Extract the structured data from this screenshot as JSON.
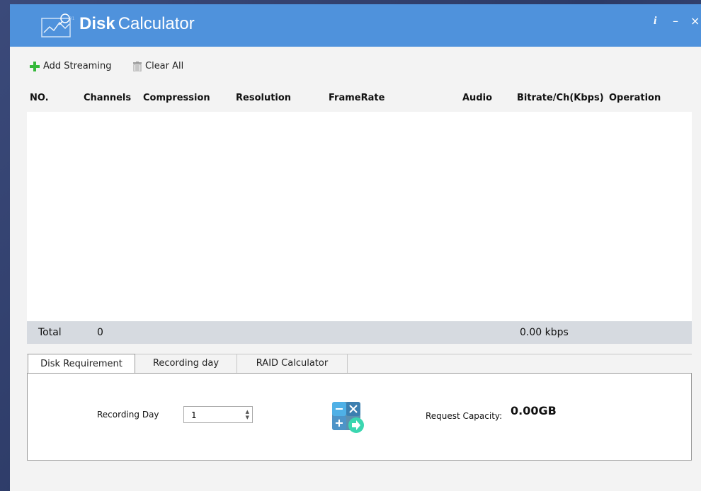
{
  "app": {
    "title_bold": "Disk",
    "title_light": "Calculator",
    "logo_icon": "chart-magnifier-logo-icon",
    "controls": {
      "info": "i",
      "minimize": "–",
      "close": "×"
    }
  },
  "toolbar": {
    "add_label": "Add Streaming",
    "add_icon": "plus-icon",
    "clear_label": "Clear All",
    "clear_icon": "trash-icon"
  },
  "table": {
    "columns": [
      "NO.",
      "Channels",
      "Compression",
      "Resolution",
      "FrameRate",
      "Audio",
      "Bitrate/Ch(Kbps)",
      "Operation"
    ],
    "rows": [],
    "total_label": "Total",
    "total_count": "0",
    "total_bitrate": "0.00 kbps"
  },
  "tabs": {
    "items": [
      "Disk Requirement",
      "Recording day",
      "RAID Calculator"
    ],
    "active": 0
  },
  "panel": {
    "recording_day_label": "Recording Day",
    "recording_day_value": "1",
    "calc_icon": "calculator-icon",
    "request_capacity_label": "Request Capacity:",
    "request_capacity_value": "0.00GB"
  },
  "colors": {
    "titlebar": "#4f92dc",
    "plus": "#35b83a",
    "total_row": "#d6dae0"
  }
}
